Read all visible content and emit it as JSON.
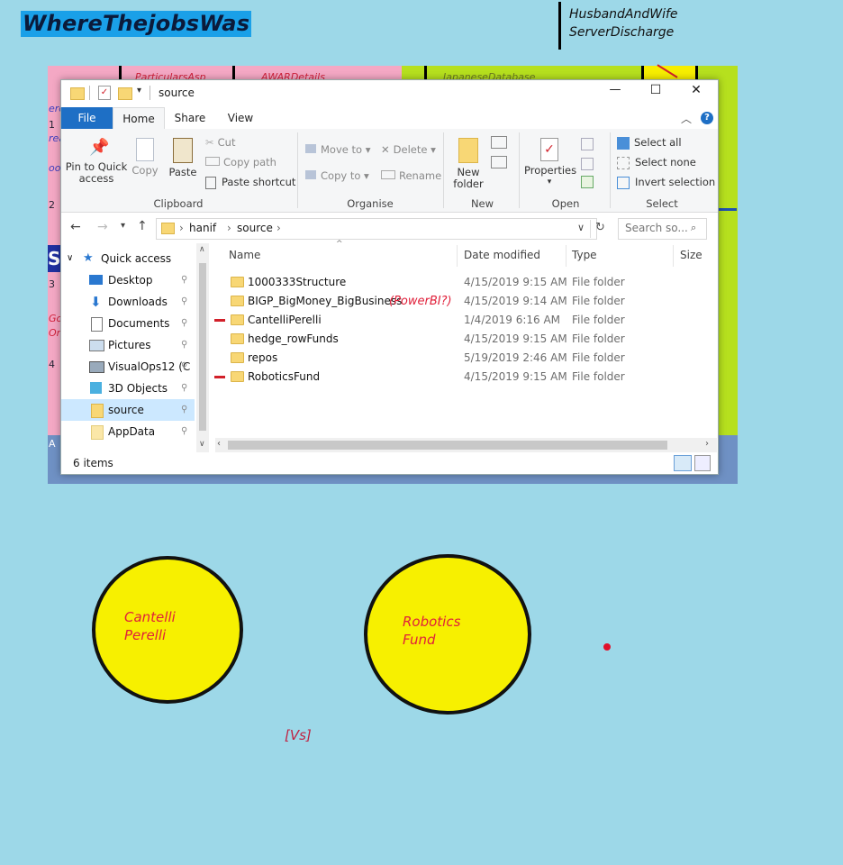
{
  "brand": {
    "title": "WhereThejobsWas"
  },
  "note": {
    "line1": "HusbandAndWife",
    "line2": "ServerDischarge"
  },
  "background": {
    "fragments": [
      "ParticularsAsp",
      "AWARDetails",
      "JapaneseDatabase"
    ],
    "edge": [
      "erc",
      "1",
      "rea",
      "ood",
      "2",
      "S",
      "3",
      "Go",
      "On",
      "4",
      "A"
    ]
  },
  "window": {
    "title": "source",
    "title_icons": [
      "folder-icon",
      "properties-icon",
      "new-folder-icon",
      "dropdown-icon"
    ],
    "controls": {
      "minimize": "—",
      "maximize": "☐",
      "close": "✕"
    },
    "tabs": {
      "file": "File",
      "home": "Home",
      "share": "Share",
      "view": "View"
    },
    "ribbon": {
      "clipboard": {
        "pin_label": "Pin to Quick access",
        "copy_label": "Copy",
        "paste_label": "Paste",
        "cut_label": "Cut",
        "copy_path_label": "Copy path",
        "paste_shortcut_label": "Paste shortcut",
        "group": "Clipboard"
      },
      "organise": {
        "move_to_label": "Move to",
        "copy_to_label": "Copy to",
        "delete_label": "Delete",
        "rename_label": "Rename",
        "group": "Organise"
      },
      "new": {
        "new_folder_label": "New folder",
        "group": "New"
      },
      "open": {
        "properties_label": "Properties",
        "group": "Open"
      },
      "select": {
        "select_all_label": "Select all",
        "select_none_label": "Select none",
        "invert_label": "Invert selection",
        "group": "Select"
      }
    },
    "address": {
      "path": [
        "hanif",
        "source"
      ],
      "search_placeholder": "Search so..."
    },
    "nav": {
      "quick_access": "Quick access",
      "items": [
        {
          "label": "Desktop",
          "icon": "desktop-icon"
        },
        {
          "label": "Downloads",
          "icon": "download-icon"
        },
        {
          "label": "Documents",
          "icon": "documents-icon"
        },
        {
          "label": "Pictures",
          "icon": "pictures-icon"
        },
        {
          "label": "VisualOps12 (C",
          "icon": "network-drive-icon"
        },
        {
          "label": "3D Objects",
          "icon": "3d-objects-icon"
        },
        {
          "label": "source",
          "icon": "folder-icon"
        },
        {
          "label": "AppData",
          "icon": "folder-icon"
        }
      ]
    },
    "columns": {
      "name": "Name",
      "date": "Date modified",
      "type": "Type",
      "size": "Size"
    },
    "files": [
      {
        "name": "1000333Structure",
        "date": "4/15/2019 9:15 AM",
        "type": "File folder"
      },
      {
        "name": "BIGP_BigMoney_BigBusiness",
        "date": "4/15/2019 9:14 AM",
        "type": "File folder",
        "annotation": "(PowerBI?)"
      },
      {
        "name": "CantelliPerelli",
        "date": "1/4/2019 6:16 AM",
        "type": "File folder"
      },
      {
        "name": "hedge_rowFunds",
        "date": "4/15/2019 9:15 AM",
        "type": "File folder"
      },
      {
        "name": "repos",
        "date": "5/19/2019 2:46 AM",
        "type": "File folder"
      },
      {
        "name": "RoboticsFund",
        "date": "4/15/2019 9:15 AM",
        "type": "File folder"
      }
    ],
    "status": {
      "count": "6 items"
    }
  },
  "circles": {
    "left": {
      "line1": "Cantelli",
      "line2": "Perelli"
    },
    "right": {
      "line1": "Robotics",
      "line2": "Fund"
    }
  },
  "versus": "[Vs]",
  "colors": {
    "accent": "#1e6fc5",
    "annotation": "#e0203a",
    "circle": "#f7f000",
    "page": "#9dd8e8"
  }
}
